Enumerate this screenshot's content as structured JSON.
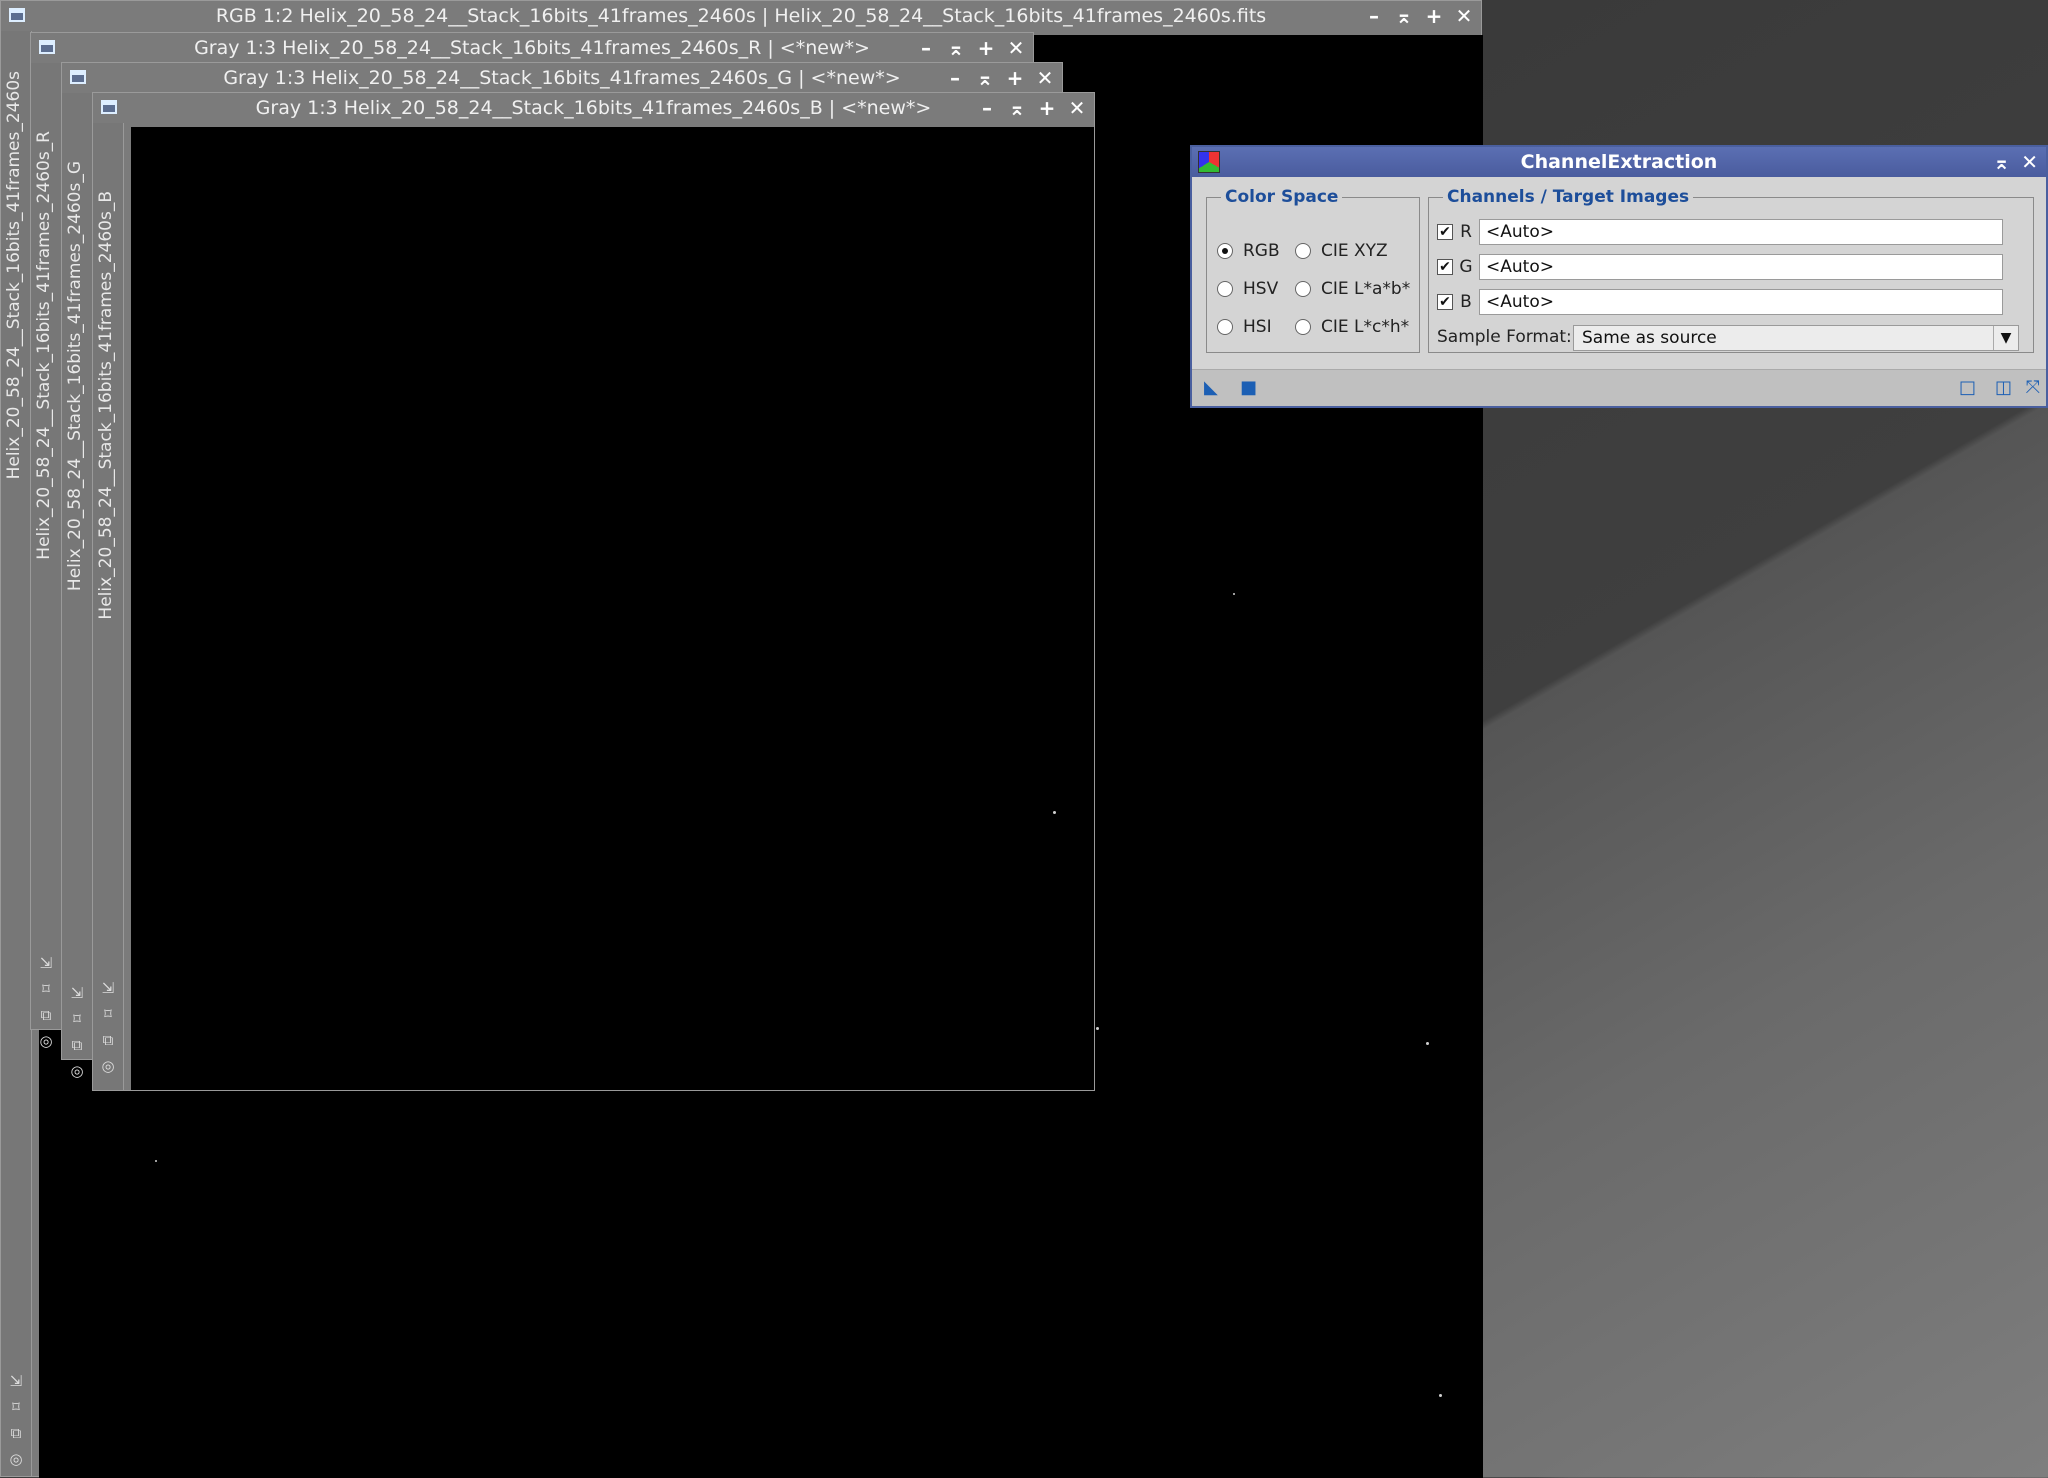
{
  "windows": {
    "rgb": {
      "title": "RGB 1:2 Helix_20_58_24__Stack_16bits_41frames_2460s | Helix_20_58_24__Stack_16bits_41frames_2460s.fits",
      "side_label": "Helix_20_58_24__Stack_16bits_41frames_2460s"
    },
    "r": {
      "title": "Gray 1:3 Helix_20_58_24__Stack_16bits_41frames_2460s_R | <*new*>",
      "side_label": "Helix_20_58_24__Stack_16bits_41frames_2460s_R"
    },
    "g": {
      "title": "Gray 1:3 Helix_20_58_24__Stack_16bits_41frames_2460s_G | <*new*>",
      "side_label": "Helix_20_58_24__Stack_16bits_41frames_2460s_G"
    },
    "b": {
      "title": "Gray 1:3 Helix_20_58_24__Stack_16bits_41frames_2460s_B | <*new*>",
      "side_label": "Helix_20_58_24__Stack_16bits_41frames_2460s_B"
    },
    "buttons": {
      "minimize": "–",
      "shade": "⌅",
      "maximize": "+",
      "close": "✕"
    }
  },
  "dialog": {
    "title": "ChannelExtraction",
    "color_space": {
      "legend": "Color Space",
      "options": [
        "RGB",
        "CIE XYZ",
        "HSV",
        "CIE L*a*b*",
        "HSI",
        "CIE L*c*h*"
      ],
      "selected": "RGB"
    },
    "channels": {
      "legend": "Channels / Target Images",
      "rows": [
        {
          "label": "R",
          "checked": true,
          "value": "<Auto>"
        },
        {
          "label": "G",
          "checked": true,
          "value": "<Auto>"
        },
        {
          "label": "B",
          "checked": true,
          "value": "<Auto>"
        }
      ],
      "sample_format_label": "Sample Format:",
      "sample_format_value": "Same as source"
    },
    "colors": {
      "title_bar": "#4a5c9e",
      "legend": "#1d4e9a",
      "accent": "#1c5fb4"
    }
  }
}
